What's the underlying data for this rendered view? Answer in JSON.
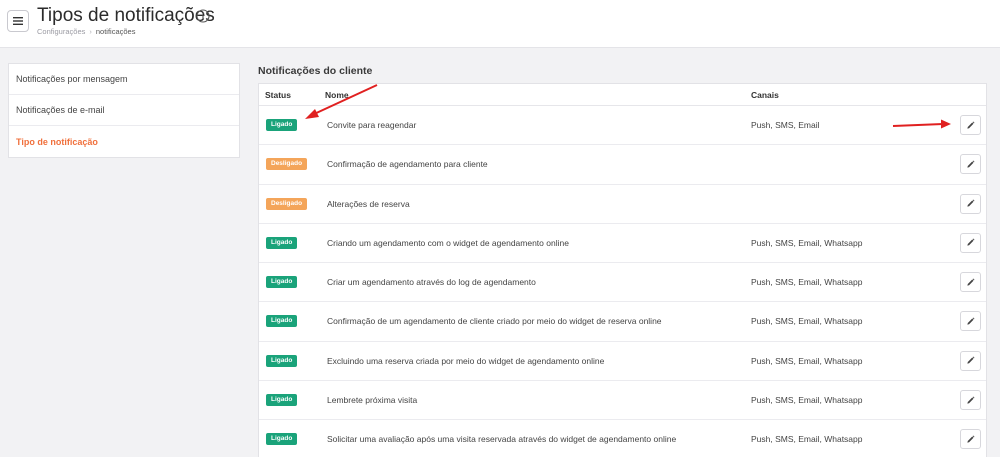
{
  "header": {
    "title": "Tipos de notificações",
    "menu_icon": "hamburger-menu-icon",
    "info_icon": "info-icon",
    "breadcrumb": [
      "Configurações",
      "notificações"
    ]
  },
  "sidebar": {
    "items": [
      {
        "label": "Notificações por mensagem",
        "active": false
      },
      {
        "label": "Notificações de e-mail",
        "active": false
      },
      {
        "label": "Tipo de notificação",
        "active": true
      }
    ]
  },
  "section": {
    "title": "Notificações do cliente",
    "columns": {
      "status": "Status",
      "name": "Nome",
      "channels": "Canais"
    }
  },
  "rows": [
    {
      "status": "Ligado",
      "state": "on",
      "name": "Convite para reagendar",
      "channels": "Push, SMS, Email"
    },
    {
      "status": "Desligado",
      "state": "off",
      "name": "Confirmação de agendamento para cliente",
      "channels": ""
    },
    {
      "status": "Desligado",
      "state": "off",
      "name": "Alterações de reserva",
      "channels": ""
    },
    {
      "status": "Ligado",
      "state": "on",
      "name": "Criando um agendamento com o widget de agendamento online",
      "channels": "Push, SMS, Email, Whatsapp"
    },
    {
      "status": "Ligado",
      "state": "on",
      "name": "Criar um agendamento através do log de agendamento",
      "channels": "Push, SMS, Email, Whatsapp"
    },
    {
      "status": "Ligado",
      "state": "on",
      "name": "Confirmação de um agendamento de cliente criado por meio do widget de reserva online",
      "channels": "Push, SMS, Email, Whatsapp"
    },
    {
      "status": "Ligado",
      "state": "on",
      "name": "Excluindo uma reserva criada por meio do widget de agendamento online",
      "channels": "Push, SMS, Email, Whatsapp"
    },
    {
      "status": "Ligado",
      "state": "on",
      "name": "Lembrete próxima visita",
      "channels": "Push, SMS, Email, Whatsapp"
    },
    {
      "status": "Ligado",
      "state": "on",
      "name": "Solicitar uma avaliação após uma visita reservada através do widget de agendamento online",
      "channels": "Push, SMS, Email, Whatsapp"
    }
  ],
  "colors": {
    "on": "#1aa37a",
    "off": "#f4a55a",
    "accent": "#f0703c",
    "annotation_arrow": "#e02020"
  },
  "edit_icon": "pencil-icon"
}
